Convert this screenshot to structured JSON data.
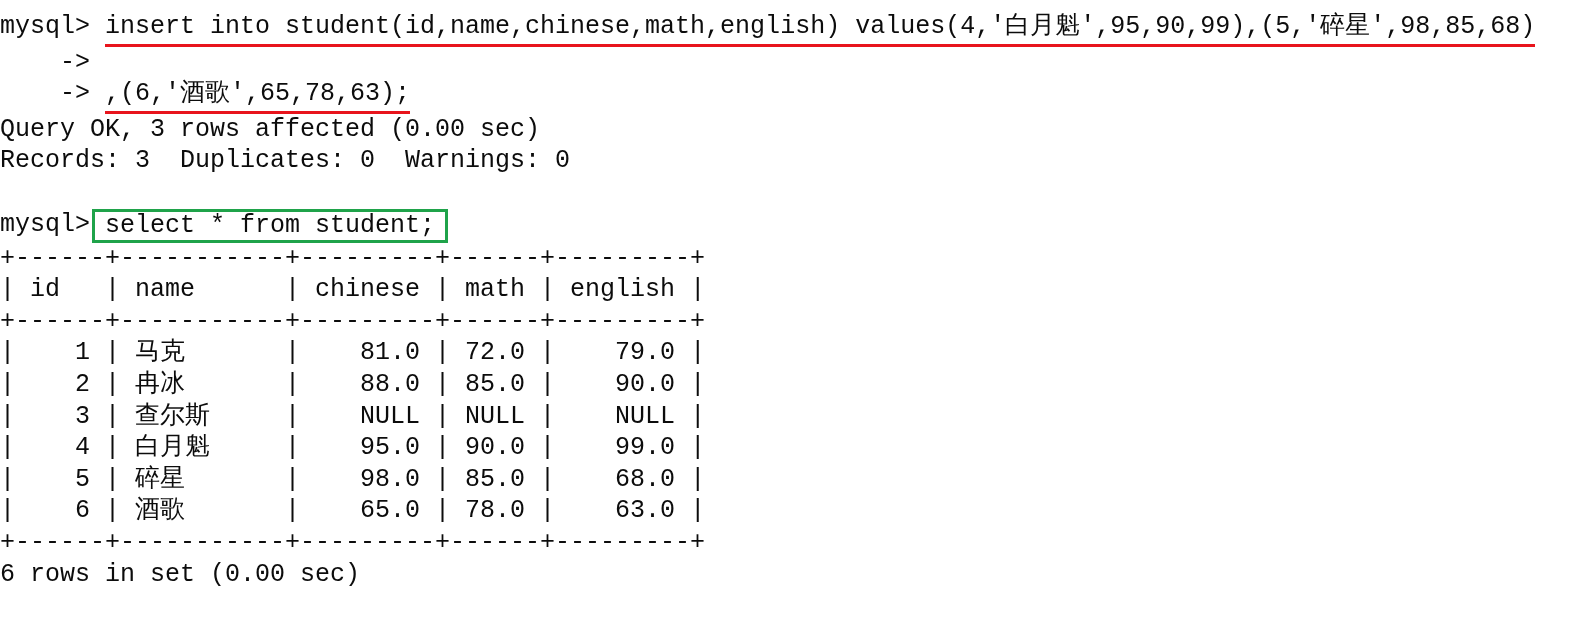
{
  "lines": [
    {
      "kind": "prompt",
      "prompt": "mysql>",
      "command": "insert into student(id,name,chinese,math,english) values(4,'白月魁',95,90,99),(5,'碎星',98,85,68)",
      "mark": {
        "kind": "underline",
        "color": "#e8141c"
      }
    },
    {
      "kind": "continuation",
      "prompt": "->"
    },
    {
      "kind": "continuation",
      "prompt": "->",
      "command": ",(6,'酒歌',65,78,63);",
      "mark": {
        "kind": "underline",
        "color": "#e8141c"
      }
    },
    {
      "kind": "output",
      "text": "Query OK, 3 rows affected (0.00 sec)"
    },
    {
      "kind": "output",
      "text": "Records: 3  Duplicates: 0  Warnings: 0"
    },
    {
      "kind": "blank"
    },
    {
      "kind": "prompt",
      "prompt": "mysql>",
      "command": "select * from student;",
      "mark": {
        "kind": "box",
        "color": "#1fa34a"
      }
    },
    {
      "kind": "table"
    },
    {
      "kind": "output",
      "text": "6 rows in set (0.00 sec)"
    }
  ],
  "table": {
    "border": "+------+-----------+---------+------+---------+",
    "separator": "|",
    "columns": [
      {
        "header": "id",
        "kind": "number"
      },
      {
        "header": "name",
        "kind": "text"
      },
      {
        "header": "chinese",
        "kind": "number"
      },
      {
        "header": "math",
        "kind": "text"
      },
      {
        "header": "english",
        "kind": "number"
      }
    ],
    "rows": [
      [
        "1",
        "马克",
        "81.0",
        "72.0",
        "79.0"
      ],
      [
        "2",
        "冉冰",
        "88.0",
        "85.0",
        "90.0"
      ],
      [
        "3",
        "查尔斯",
        "NULL",
        "NULL",
        "NULL"
      ],
      [
        "4",
        "白月魁",
        "95.0",
        "90.0",
        "99.0"
      ],
      [
        "5",
        "碎星",
        "98.0",
        "85.0",
        "68.0"
      ],
      [
        "6",
        "酒歌",
        "65.0",
        "78.0",
        "63.0"
      ]
    ]
  }
}
